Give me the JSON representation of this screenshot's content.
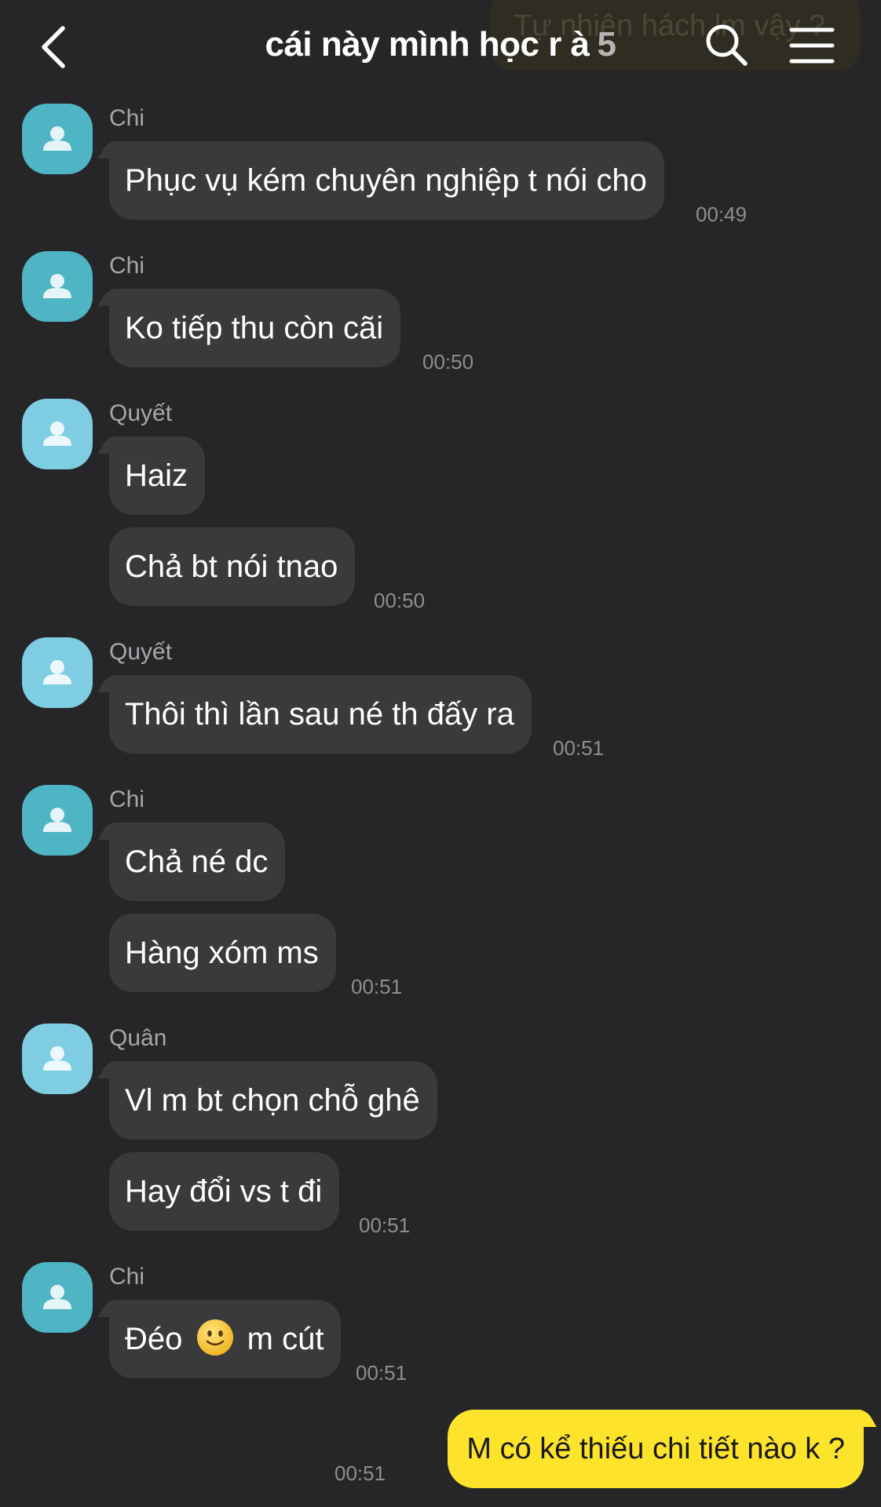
{
  "header": {
    "title": "cái này mình học r à",
    "member_count": "5",
    "ghost_text": "Tự nhiên hách lm vậy ?"
  },
  "colors": {
    "background": "#262628",
    "incoming_bubble": "#3a3a3c",
    "outgoing_bubble": "#fde42b",
    "avatar_teal": "#4fb4c4",
    "avatar_light": "#7fcde3"
  },
  "icons": {
    "back": "chevron-left-icon",
    "search": "search-icon",
    "menu": "menu-icon",
    "avatar": "person-icon",
    "emoji": "slightly-smiling-face"
  },
  "messages": [
    {
      "sender": "Chi",
      "bubbles": [
        "Phục vụ kém chuyên nghiệp t nói cho"
      ],
      "time": "00:49"
    },
    {
      "sender": "Chi",
      "bubbles": [
        "Ko tiếp thu còn cãi"
      ],
      "time": "00:50"
    },
    {
      "sender": "Quyết",
      "bubbles": [
        "Haiz",
        "Chả bt nói tnao"
      ],
      "time": "00:50"
    },
    {
      "sender": "Quyết",
      "bubbles": [
        "Thôi thì lần sau né th đấy ra"
      ],
      "time": "00:51"
    },
    {
      "sender": "Chi",
      "bubbles": [
        "Chả né dc",
        "Hàng xóm ms"
      ],
      "time": "00:51"
    },
    {
      "sender": "Quân",
      "bubbles": [
        "Vl m bt chọn chỗ ghê",
        "Hay đổi vs t đi"
      ],
      "time": "00:51"
    },
    {
      "sender": "Chi",
      "bubbles": [
        "Đéo",
        "m cút"
      ],
      "time": "00:51"
    }
  ],
  "outgoing": {
    "text": "M có kể thiếu chi tiết nào k ?",
    "time": "00:51"
  }
}
